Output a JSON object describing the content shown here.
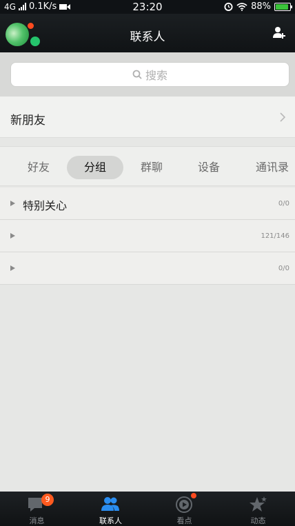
{
  "status_bar": {
    "network": "4G",
    "speed": "0.1K/s",
    "time": "23:20",
    "battery": "88%"
  },
  "header": {
    "title": "联系人"
  },
  "search": {
    "placeholder": "搜索"
  },
  "new_friends": {
    "label": "新朋友"
  },
  "tabs": [
    {
      "label": "好友"
    },
    {
      "label": "分组"
    },
    {
      "label": "群聊"
    },
    {
      "label": "设备"
    },
    {
      "label": "通讯录"
    }
  ],
  "groups": [
    {
      "name": "特别关心",
      "count": "0/0"
    },
    {
      "name": "",
      "count": "121/146"
    },
    {
      "name": "",
      "count": "0/0"
    }
  ],
  "bottom_nav": [
    {
      "label": "消息",
      "badge": "9"
    },
    {
      "label": "联系人"
    },
    {
      "label": "看点"
    },
    {
      "label": "动态"
    }
  ],
  "colors": {
    "accent_blue": "#2a8df0",
    "badge_orange": "#ff5a1f",
    "battery_green": "#3ac33a"
  }
}
